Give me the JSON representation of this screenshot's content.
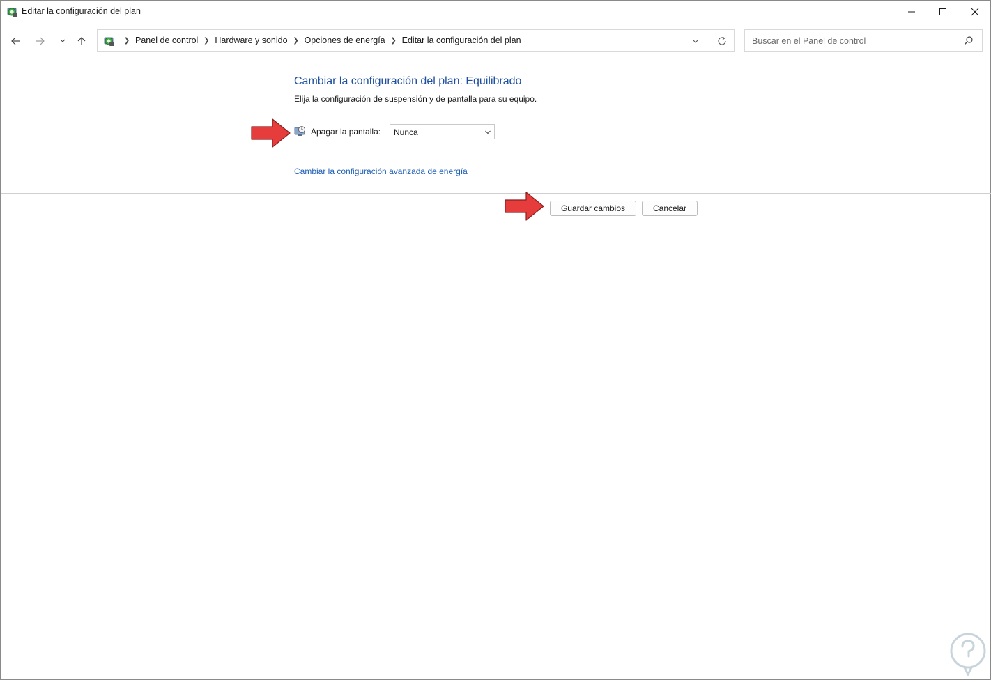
{
  "window": {
    "title": "Editar la configuración del plan"
  },
  "nav": {
    "breadcrumbs": [
      "Panel de control",
      "Hardware y sonido",
      "Opciones de energía",
      "Editar la configuración del plan"
    ]
  },
  "search": {
    "placeholder": "Buscar en el Panel de control"
  },
  "content": {
    "heading": "Cambiar la configuración del plan: Equilibrado",
    "subheading": "Elija la configuración de suspensión y de pantalla para su equipo.",
    "display_off_label": "Apagar la pantalla:",
    "display_off_value": "Nunca",
    "advanced_link": "Cambiar la configuración avanzada de energía"
  },
  "actions": {
    "save_label": "Guardar cambios",
    "cancel_label": "Cancelar"
  },
  "annotations": {
    "arrow_color": "#e63c3c"
  },
  "icons": {
    "app": "control-panel-power-icon",
    "screen": "display-timer-icon"
  },
  "colors": {
    "heading": "#1e4fa0",
    "link": "#1e5fb5"
  }
}
